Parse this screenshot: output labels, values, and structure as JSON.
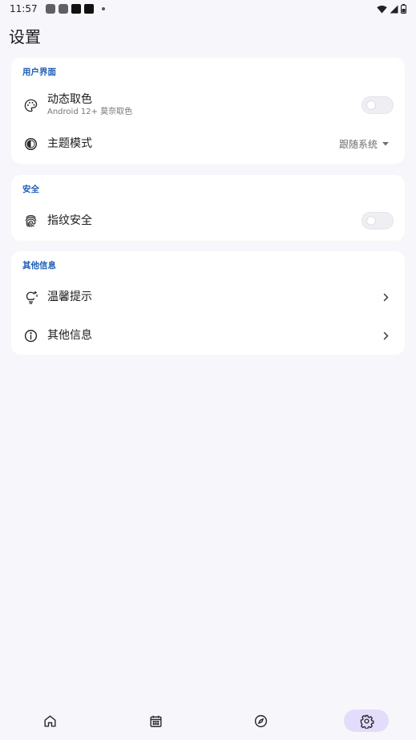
{
  "status_bar": {
    "time": "11:57",
    "notification_icons": [
      "app-notification-icon",
      "app-notification-icon",
      "app-notification-icon",
      "app-notification-icon"
    ],
    "indicators": [
      "wifi-icon",
      "signal-icon",
      "battery-icon"
    ]
  },
  "page": {
    "title": "设置"
  },
  "sections": {
    "ui": {
      "header": "用户界面",
      "dynamic_color": {
        "title": "动态取色",
        "subtitle": "Android 12+ 莫奈取色",
        "enabled": false,
        "icon": "palette-icon"
      },
      "theme_mode": {
        "title": "主题模式",
        "value": "跟随系统",
        "icon": "contrast-icon"
      }
    },
    "security": {
      "header": "安全",
      "fingerprint": {
        "title": "指纹安全",
        "enabled": false,
        "icon": "fingerprint-icon"
      }
    },
    "other": {
      "header": "其他信息",
      "tips": {
        "title": "温馨提示",
        "icon": "lightbulb-icon"
      },
      "about": {
        "title": "其他信息",
        "icon": "info-icon"
      }
    }
  },
  "bottom_nav": {
    "items": [
      {
        "icon": "home-icon",
        "active": false
      },
      {
        "icon": "calendar-icon",
        "active": false
      },
      {
        "icon": "compass-icon",
        "active": false
      },
      {
        "icon": "gear-icon",
        "active": true
      }
    ]
  },
  "colors": {
    "accent": "#1f5fb5",
    "background": "#f7f7fb",
    "card": "#ffffff",
    "nav_active": "#e4dcfb"
  }
}
